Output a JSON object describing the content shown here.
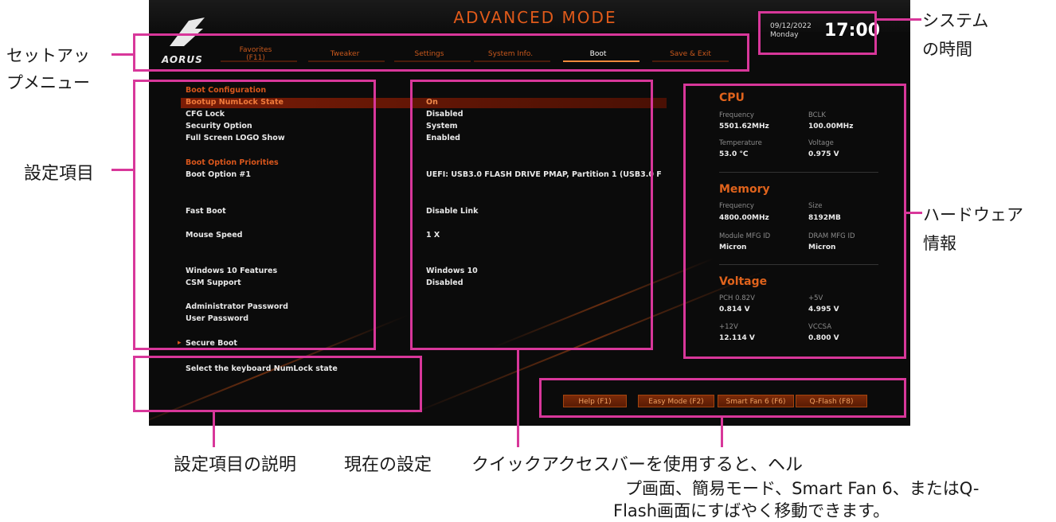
{
  "bios": {
    "title": "ADVANCED MODE",
    "logo": "AORUS",
    "clock": {
      "date": "09/12/2022",
      "day": "Monday",
      "time": "17:00"
    },
    "menu": [
      {
        "label": "Favorites (F11)",
        "active": false
      },
      {
        "label": "Tweaker",
        "active": false
      },
      {
        "label": "Settings",
        "active": false
      },
      {
        "label": "System Info.",
        "active": false
      },
      {
        "label": "Boot",
        "active": true
      },
      {
        "label": "Save & Exit",
        "active": false
      }
    ],
    "settings": {
      "boot_configuration_heading": "Boot Configuration",
      "bootup_numlock": {
        "label": "Bootup NumLock State",
        "value": "On"
      },
      "cfg_lock": {
        "label": "CFG Lock",
        "value": "Disabled"
      },
      "security_option": {
        "label": "Security Option",
        "value": "System"
      },
      "full_screen_logo": {
        "label": "Full Screen LOGO Show",
        "value": "Enabled"
      },
      "boot_priorities_heading": "Boot Option Priorities",
      "boot_option_1": {
        "label": "Boot Option #1",
        "value": "UEFI: USB3.0 FLASH DRIVE PMAP, Partition 1 (USB3.0 F"
      },
      "fast_boot": {
        "label": "Fast Boot",
        "value": "Disable Link"
      },
      "mouse_speed": {
        "label": "Mouse Speed",
        "value": "1 X"
      },
      "windows_10_features": {
        "label": "Windows 10 Features",
        "value": "Windows 10"
      },
      "csm_support": {
        "label": "CSM Support",
        "value": "Disabled"
      },
      "admin_password": {
        "label": "Administrator Password"
      },
      "user_password": {
        "label": "User Password"
      },
      "secure_boot": {
        "label": "Secure Boot"
      }
    },
    "hardware": {
      "cpu": {
        "heading": "CPU",
        "frequency_label": "Frequency",
        "frequency_value": "5501.62MHz",
        "bclk_label": "BCLK",
        "bclk_value": "100.00MHz",
        "temperature_label": "Temperature",
        "temperature_value": "53.0 °C",
        "voltage_label": "Voltage",
        "voltage_value": "0.975 V"
      },
      "memory": {
        "heading": "Memory",
        "frequency_label": "Frequency",
        "frequency_value": "4800.00MHz",
        "size_label": "Size",
        "size_value": "8192MB",
        "module_label": "Module MFG ID",
        "module_value": "Micron",
        "dram_label": "DRAM MFG ID",
        "dram_value": "Micron"
      },
      "voltage": {
        "heading": "Voltage",
        "pch_label": "PCH 0.82V",
        "pch_value": "0.814 V",
        "p5v_label": "+5V",
        "p5v_value": "4.995 V",
        "p12v_label": "+12V",
        "p12v_value": "12.114 V",
        "vccsa_label": "VCCSA",
        "vccsa_value": "0.800 V"
      }
    },
    "description": "Select the keyboard NumLock state",
    "quick_access": [
      {
        "label": "Help (F1)"
      },
      {
        "label": "Easy Mode (F2)"
      },
      {
        "label": "Smart Fan 6 (F6)"
      },
      {
        "label": "Q-Flash (F8)"
      }
    ]
  },
  "callouts": {
    "setup_menu_line1": "セットアッ",
    "setup_menu_line2": "プメニュー",
    "system_time_line1": "システム",
    "system_time_line2": "の時間",
    "settings_items": "設定項目",
    "hardware_info_line1": "ハードウェア",
    "hardware_info_line2": "情報",
    "item_description": "設定項目の説明",
    "current_settings": "現在の設定",
    "quick_access_line1": "クイックアクセスバーを使用すると、ヘル",
    "quick_access_line2": "プ画面、簡易モード、Smart Fan 6、またはQ-",
    "quick_access_line3": "Flash画面にすばやく移動できます。"
  },
  "colors": {
    "callout": "#d8379a",
    "accent": "#e05a1a",
    "bios_bg": "#0b0b0b"
  }
}
